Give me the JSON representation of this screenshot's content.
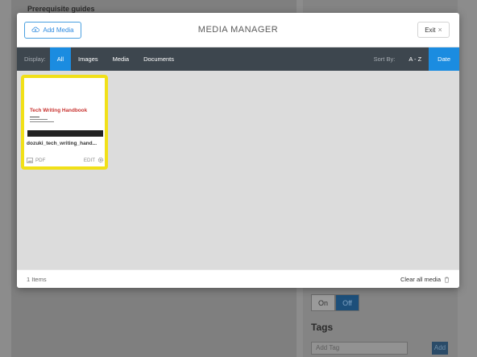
{
  "background": {
    "heading": "Prerequisite guides",
    "toggle": {
      "on": "On",
      "off": "Off",
      "selected": "Off"
    },
    "tags_heading": "Tags",
    "tag_input_placeholder": "Add Tag",
    "add_button": "Add"
  },
  "modal": {
    "title": "MEDIA MANAGER",
    "add_media_label": "Add Media",
    "exit_label": "Exit",
    "toolbar": {
      "display_label": "Display:",
      "filters": [
        "All",
        "Images",
        "Media",
        "Documents"
      ],
      "active_filter": "All",
      "sort_label": "Sort By:",
      "sorts": [
        "A - Z",
        "Date"
      ],
      "active_sort": "Date"
    },
    "items": [
      {
        "thumbnail_title": "Tech Writing Handbook",
        "file_name": "dozuki_tech_writing_hand...",
        "type": "PDF",
        "edit_label": "EDIT",
        "selected": true
      }
    ],
    "footer": {
      "items_count": "1 Items",
      "clear_all": "Clear all media"
    }
  },
  "colors": {
    "accent": "#1b8ce0",
    "toolbar_bg": "#3d464e",
    "selection_border": "#f1e018",
    "thumbnail_title": "#c8322f"
  }
}
